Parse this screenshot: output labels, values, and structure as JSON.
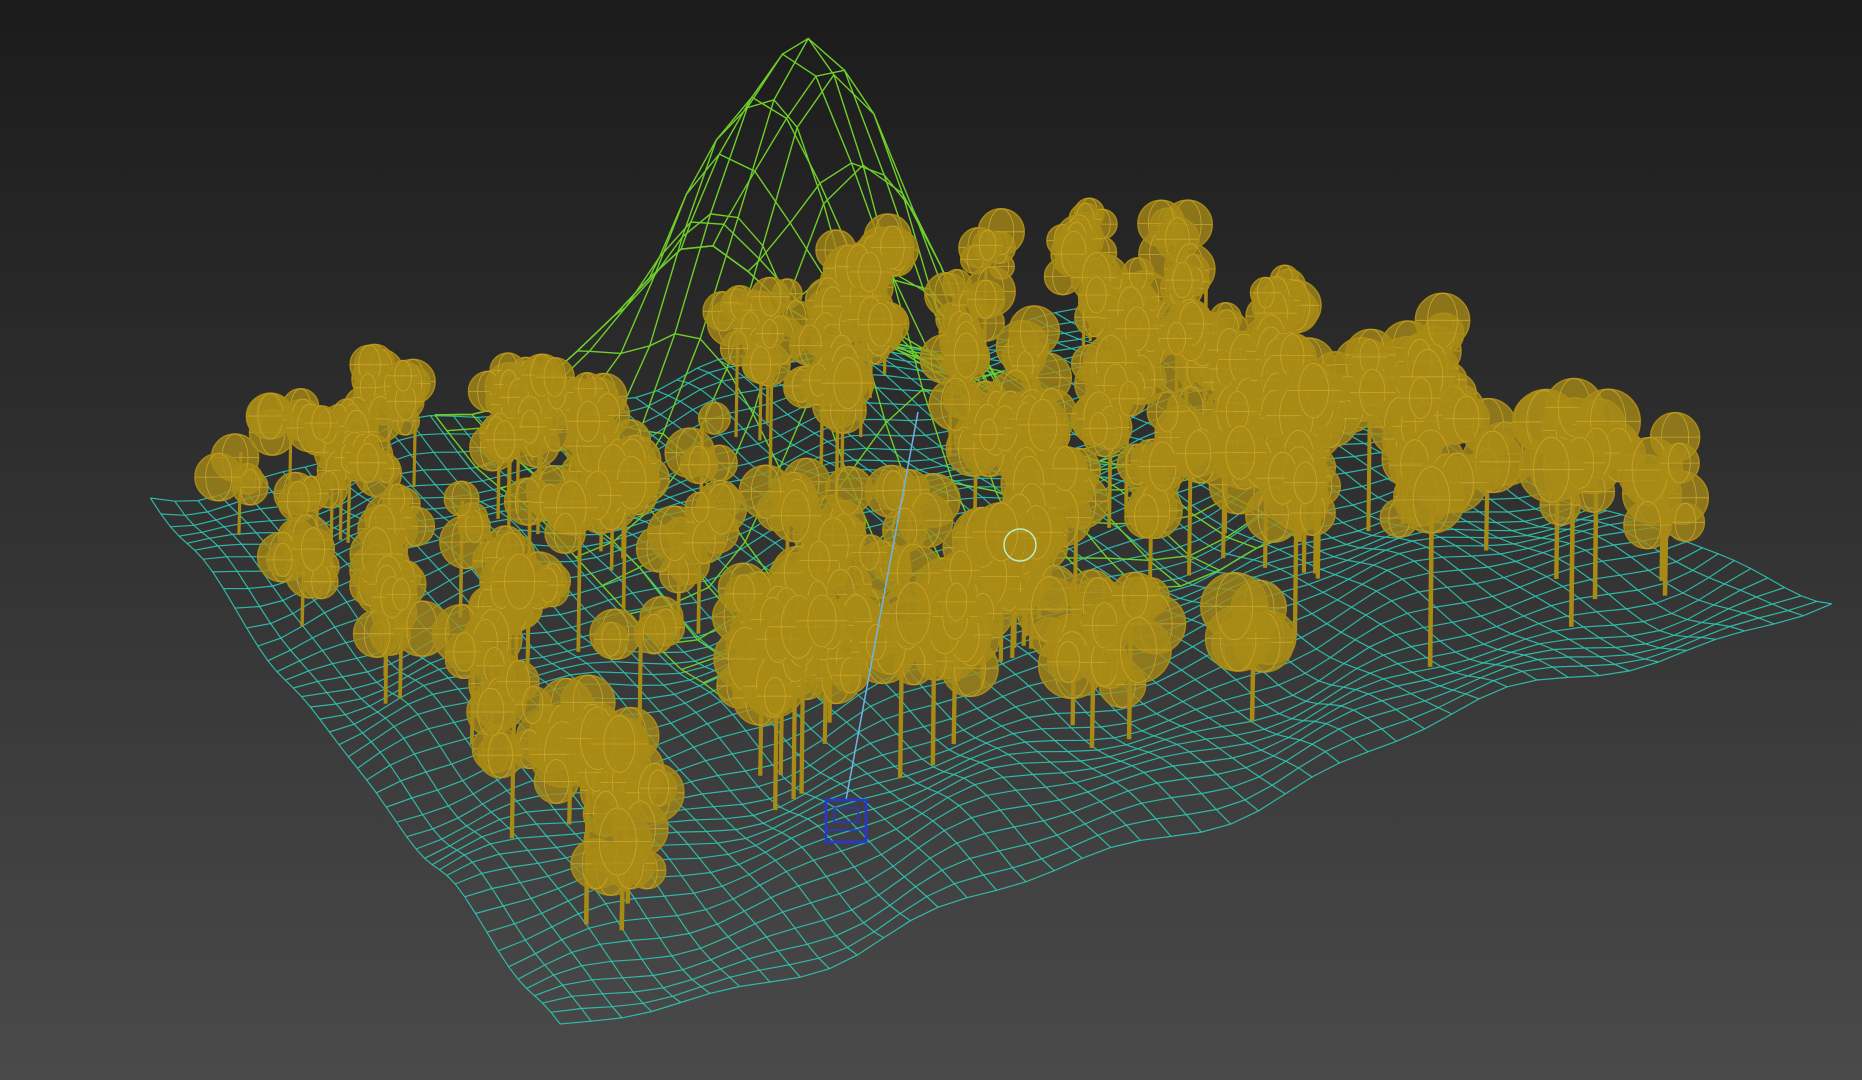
{
  "viewport": {
    "mode": "wireframe",
    "background_top": "#1b1b1b",
    "background_bottom": "#4a4a4a"
  },
  "scene": {
    "terrain": {
      "label": "terrain-plane",
      "grid_color": "#2fc5b1",
      "mountain_color": "#6fcf2a"
    },
    "trees": {
      "label": "tree-instances",
      "color": "#a88a16"
    },
    "camera_rig": {
      "label": "selected-object",
      "color": "#2238d8",
      "target_line_color": "#6fb5e6"
    },
    "helper_color": "#b9f0c8"
  }
}
